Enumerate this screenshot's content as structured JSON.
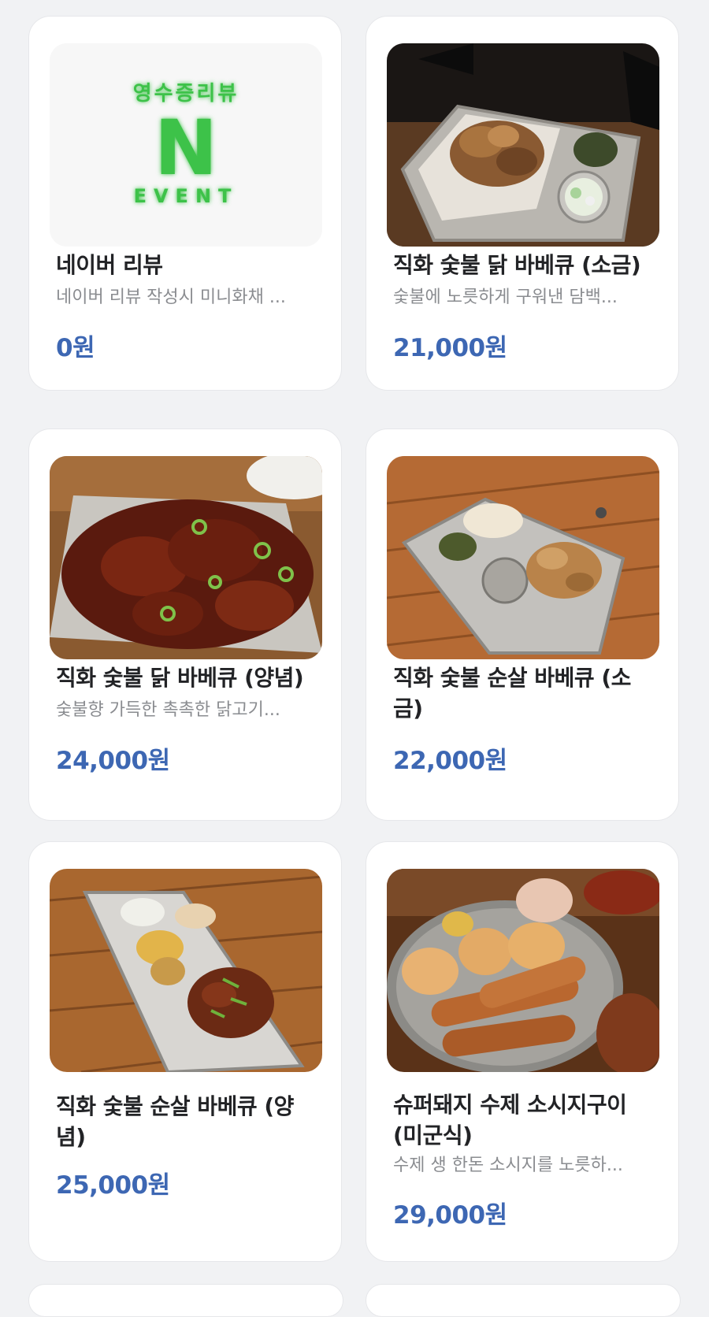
{
  "menu_items": [
    {
      "name": "네이버 리뷰",
      "description": "네이버 리뷰 작성시 미니화채 ...",
      "price": "0원",
      "image_badge": {
        "top_text": "영수증리뷰",
        "letter": "N",
        "bottom_text": "EVENT"
      }
    },
    {
      "name": "직화 숯불 닭 바베큐 (소금)",
      "description": "숯불에 노릇하게 구워낸 담백...",
      "price": "21,000원"
    },
    {
      "name": "직화 숯불 닭 바베큐 (양념)",
      "description": "숯불향 가득한 촉촉한 닭고기...",
      "price": "24,000원"
    },
    {
      "name": "직화 숯불 순살 바베큐 (소금)",
      "description": "",
      "price": "22,000원"
    },
    {
      "name": "직화 숯불 순살 바베큐 (양념)",
      "description": "",
      "price": "25,000원"
    },
    {
      "name": "슈퍼돼지 수제 소시지구이 (미군식)",
      "description": "수제 생 한돈 소시지를 노릇하...",
      "price": "29,000원"
    }
  ],
  "colors": {
    "page_background": "#f1f2f4",
    "card_background": "#ffffff",
    "price": "#3d67b3",
    "title": "#222326",
    "description": "#8a8c90",
    "badge_green": "#3ec24a"
  }
}
